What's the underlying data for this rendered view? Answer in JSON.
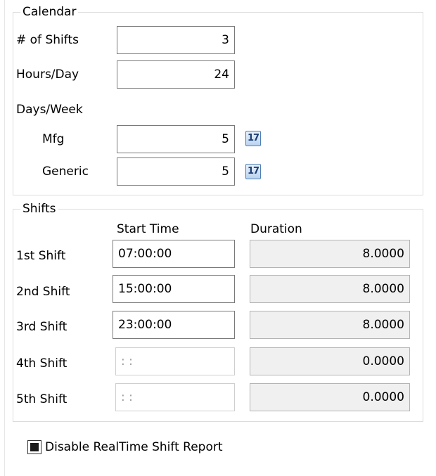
{
  "calendar": {
    "legend": "Calendar",
    "shifts_label": "# of Shifts",
    "shifts_value": "3",
    "hours_label": "Hours/Day",
    "hours_value": "24",
    "days_week_label": "Days/Week",
    "mfg_label": "Mfg",
    "mfg_value": "5",
    "generic_label": "Generic",
    "generic_value": "5",
    "calendar_icon_glyph": "17",
    "calendar_icon": "calendar-icon"
  },
  "shifts": {
    "legend": "Shifts",
    "start_time_header": "Start Time",
    "duration_header": "Duration",
    "rows": [
      {
        "label": "1st Shift",
        "start": "07:00:00",
        "duration": "8.0000",
        "enabled": true
      },
      {
        "label": "2nd Shift",
        "start": "15:00:00",
        "duration": "8.0000",
        "enabled": true
      },
      {
        "label": "3rd Shift",
        "start": "23:00:00",
        "duration": "8.0000",
        "enabled": true
      },
      {
        "label": "4th Shift",
        "start": " : :",
        "duration": "0.0000",
        "enabled": false
      },
      {
        "label": "5th Shift",
        "start": " : :",
        "duration": "0.0000",
        "enabled": false
      }
    ]
  },
  "disable_realtime": {
    "label": "Disable RealTime Shift Report",
    "checked": true
  },
  "colors": {
    "group_border": "#dcdcdc",
    "field_border": "#7a7a7a",
    "readonly_bg": "#f0f0f0"
  }
}
